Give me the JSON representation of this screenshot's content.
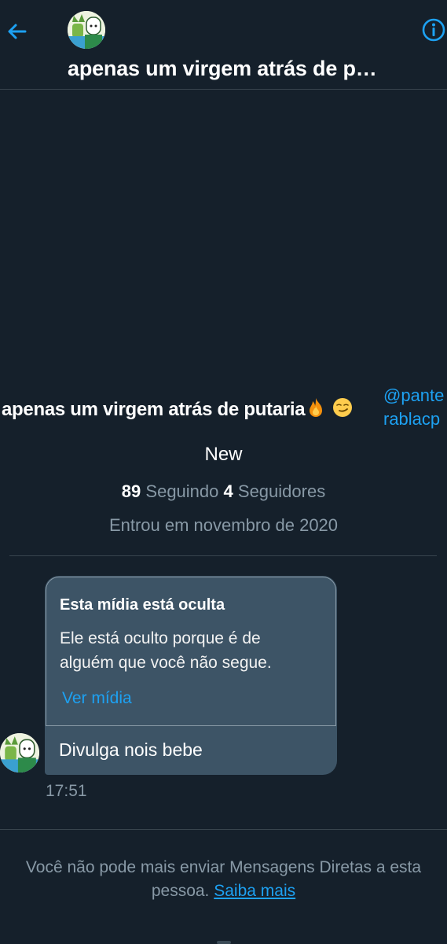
{
  "header": {
    "title": "apenas um virgem atrás de p…",
    "back_icon": "arrow-left-icon",
    "info_icon": "info-icon"
  },
  "profile": {
    "name": "apenas um virgem atrás de putaria",
    "name_emojis": [
      "fire-emoji",
      "smirk-emoji"
    ],
    "handle": "@panterablacp",
    "bio": "New",
    "following_count": "89",
    "following_label": "Seguindo",
    "followers_count": "4",
    "followers_label": "Seguidores",
    "joined": "Entrou em novembro de 2020"
  },
  "message": {
    "media_title": "Esta mídia está oculta",
    "media_description": "Ele está oculto porque é de alguém que você não segue.",
    "media_link": "Ver mídia",
    "text": "Divulga nois bebe",
    "time": "17:51"
  },
  "footer": {
    "notice": "Você não pode mais enviar Mensagens Diretas a esta pessoa.",
    "learn_more": "Saiba mais"
  },
  "colors": {
    "background": "#15202b",
    "accent": "#1da1f2",
    "bubble": "#3d5466",
    "muted": "#8899a6"
  }
}
